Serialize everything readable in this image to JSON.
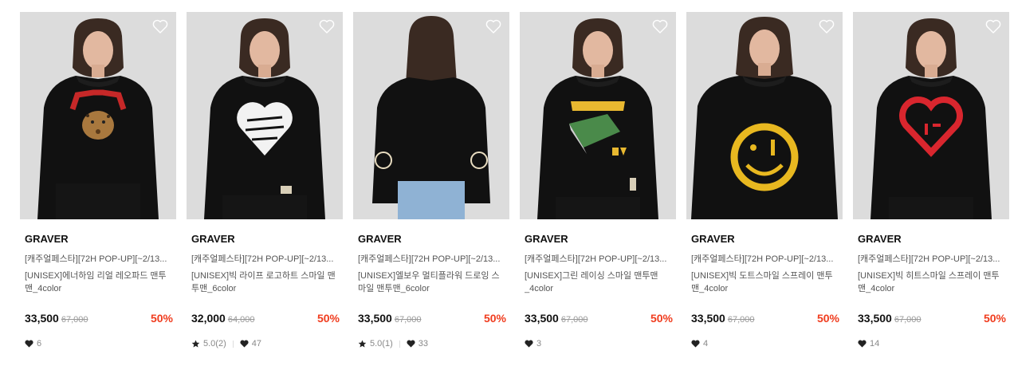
{
  "products": [
    {
      "brand": "GRAVER",
      "promo": "[캐주얼페스타][72H POP-UP][~2/13...",
      "name": "[UNISEX]에너하임 리얼 레오파드 맨투맨_4color",
      "price": "33,500",
      "original_price": "67,000",
      "discount": "50%",
      "rating": "",
      "likes": "6",
      "graphic": "anaheim-leopard",
      "pose": "front"
    },
    {
      "brand": "GRAVER",
      "promo": "[캐주얼페스타][72H POP-UP][~2/13...",
      "name": "[UNISEX]빅 라이프 로고하트 스마일 맨투맨_6color",
      "price": "32,000",
      "original_price": "64,000",
      "discount": "50%",
      "rating": "5.0(2)",
      "likes": "47",
      "graphic": "life-is-like-heart",
      "pose": "front"
    },
    {
      "brand": "GRAVER",
      "promo": "[캐주얼페스타][72H POP-UP][~2/13...",
      "name": "[UNISEX]엘보우 멀티플라워 드로잉 스마일 맨투맨_6color",
      "price": "33,500",
      "original_price": "67,000",
      "discount": "50%",
      "rating": "5.0(1)",
      "likes": "33",
      "graphic": "elbow-smiles",
      "pose": "back"
    },
    {
      "brand": "GRAVER",
      "promo": "[캐주얼페스타][72H POP-UP][~2/13...",
      "name": "[UNISEX]그린 레이싱 스마일 맨투맨_4color",
      "price": "33,500",
      "original_price": "67,000",
      "discount": "50%",
      "rating": "",
      "likes": "3",
      "graphic": "anaheim-stadium",
      "pose": "front"
    },
    {
      "brand": "GRAVER",
      "promo": "[캐주얼페스타][72H POP-UP][~2/13...",
      "name": "[UNISEX]빅 도트스마일 스프레이 맨투맨_4color",
      "price": "33,500",
      "original_price": "67,000",
      "discount": "50%",
      "rating": "",
      "likes": "4",
      "graphic": "yellow-smile",
      "pose": "front"
    },
    {
      "brand": "GRAVER",
      "promo": "[캐주얼페스타][72H POP-UP][~2/13...",
      "name": "[UNISEX]빅 히트스마일 스프레이 맨투맨_4color",
      "price": "33,500",
      "original_price": "67,000",
      "discount": "50%",
      "rating": "",
      "likes": "14",
      "graphic": "red-heart",
      "pose": "front"
    }
  ],
  "colors": {
    "discount": "#f03c1e",
    "photo_bg": "#dcdcdc",
    "sweatshirt": "#111111"
  },
  "icons": {
    "wishlist": "heart-outline-icon",
    "rating": "star-icon",
    "likes": "heart-filled-icon"
  }
}
